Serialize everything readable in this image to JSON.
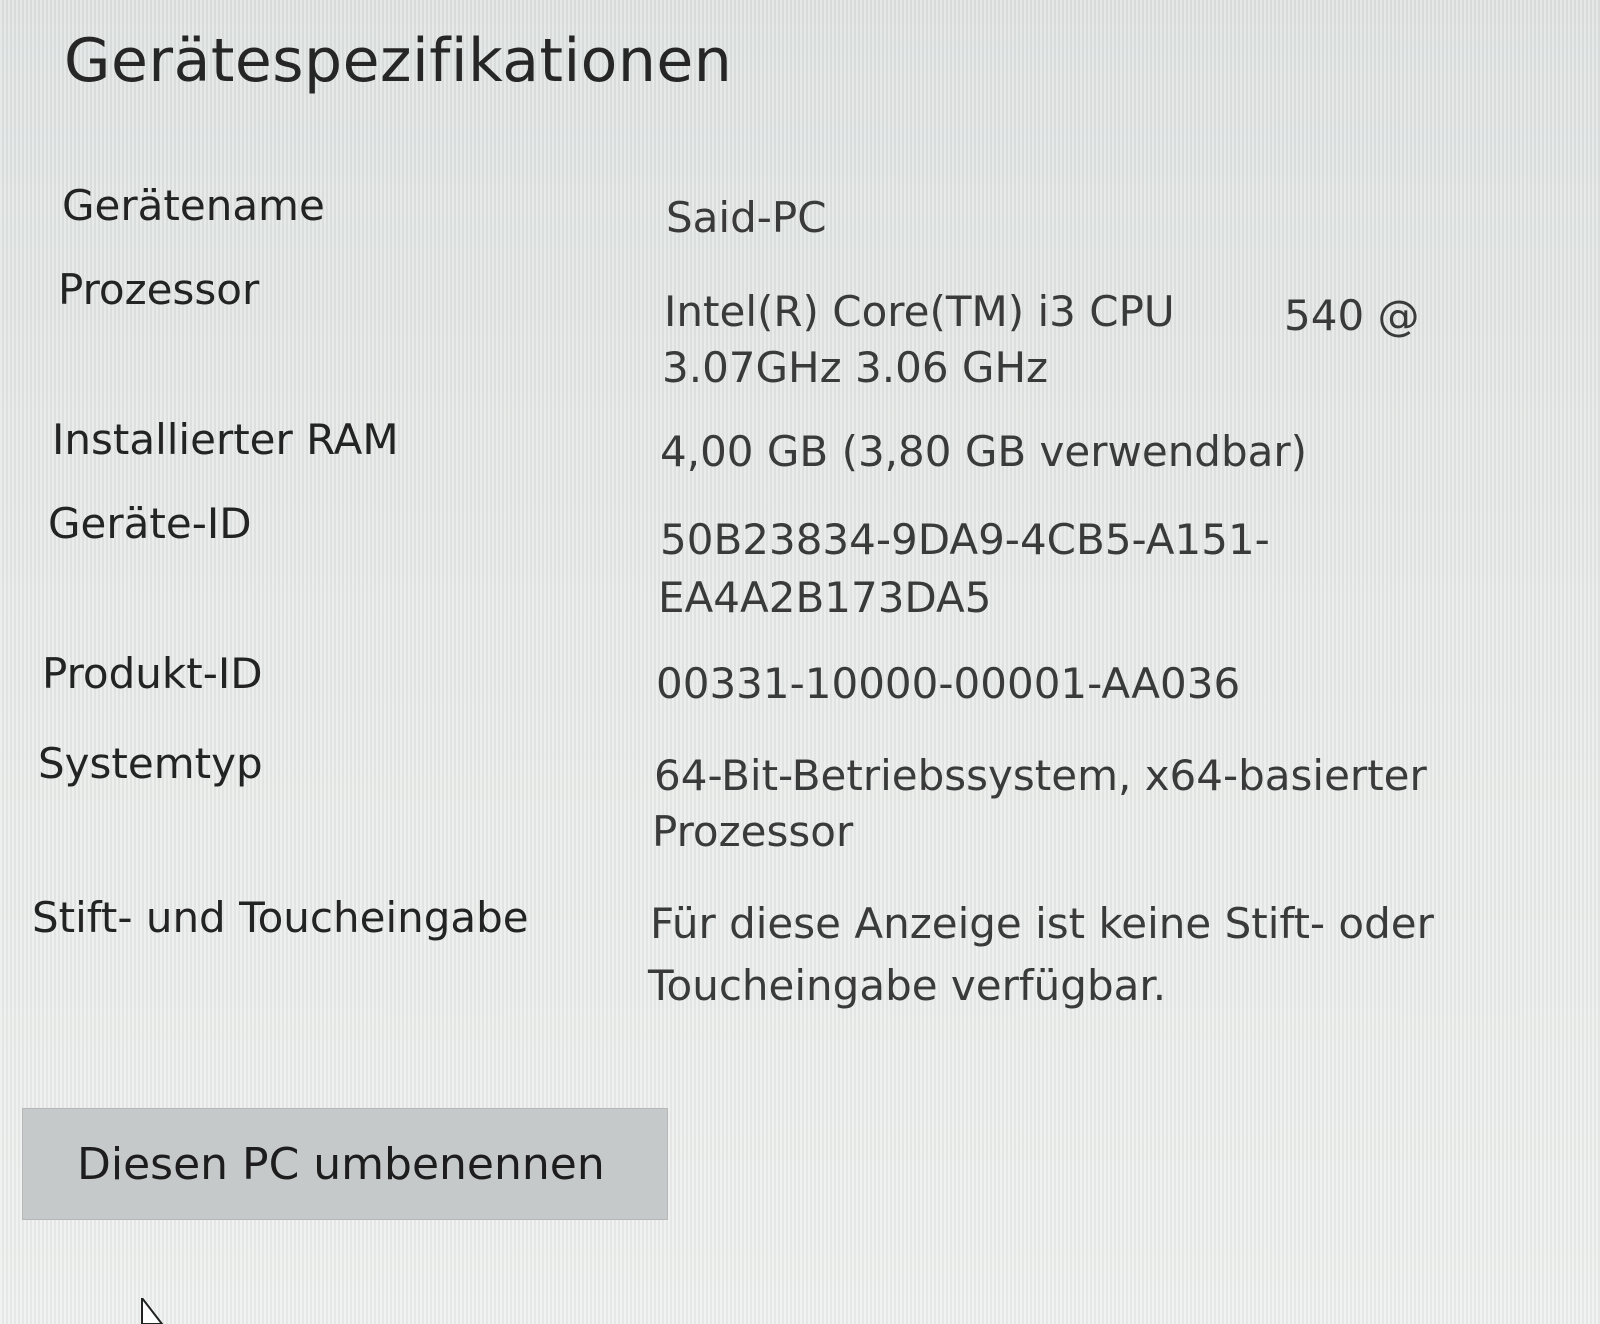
{
  "page": {
    "title": "Gerätespezifikationen"
  },
  "specs": {
    "device_name": {
      "label": "Gerätename",
      "value": "Said-PC"
    },
    "processor": {
      "label": "Prozessor",
      "value_line1": "Intel(R) Core(TM) i3 CPU",
      "value_model": "540  @",
      "value_line2": "3.07GHz   3.06 GHz"
    },
    "ram": {
      "label": "Installierter RAM",
      "value": "4,00 GB (3,80 GB verwendbar)"
    },
    "device_id": {
      "label": "Geräte-ID",
      "value_line1": "50B23834-9DA9-4CB5-A151-",
      "value_line2": "EA4A2B173DA5"
    },
    "product_id": {
      "label": "Produkt-ID",
      "value": "00331-10000-00001-AA036"
    },
    "system_type": {
      "label": "Systemtyp",
      "value_line1": "64-Bit-Betriebssystem, x64-basierter",
      "value_line2": "Prozessor"
    },
    "pen_touch": {
      "label": "Stift- und Toucheingabe",
      "value_line1": "Für diese Anzeige ist keine Stift- oder",
      "value_line2": "Toucheingabe verfügbar."
    }
  },
  "actions": {
    "rename_label": "Diesen PC umbenennen"
  },
  "icons": {
    "cursor": "mouse-pointer-icon"
  }
}
